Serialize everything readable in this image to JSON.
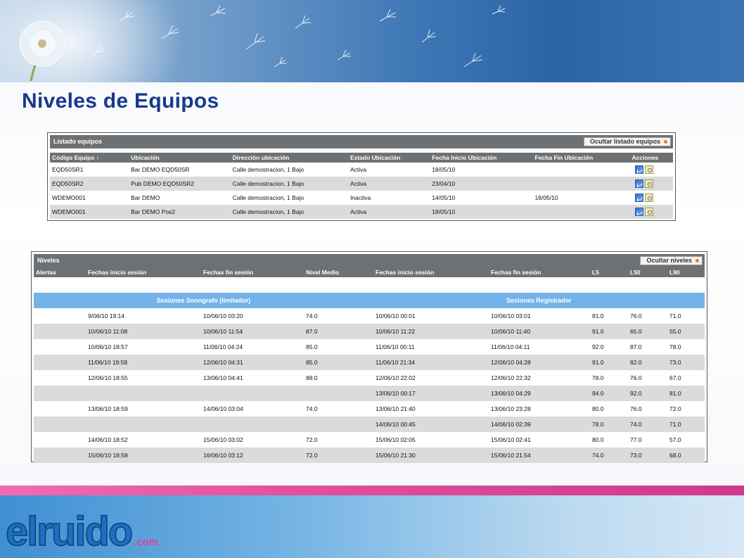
{
  "page": {
    "title": "Niveles de Equipos"
  },
  "equipos": {
    "panel_title": "Listado equipos",
    "hide_label": "Ocultar listado equipos",
    "columns": [
      "Código Equipo ↑",
      "Ubicación",
      "Dirección ubicación",
      "Estado Ubicación",
      "Fecha Inicio Ubicación",
      "Fecha Fin Ubicación",
      "Acciones"
    ],
    "rows": [
      [
        "EQD50SR1",
        "Bar DEMO EQD50SR",
        "Calle demostracion, 1 Bajo",
        "Activa",
        "18/05/10",
        ""
      ],
      [
        "EQD50SR2",
        "Pub DEMO EQD50SR2",
        "Calle demostracion, 1 Bajo",
        "Activa",
        "23/04/10",
        ""
      ],
      [
        "WDEMO001",
        "Bar DEMO",
        "Calle demostracion, 1 Bajo",
        "Inactiva",
        "14/05/10",
        "18/05/10"
      ],
      [
        "WDEMO001",
        "Bar DEMO Pos2",
        "Calle demostracion, 1 Bajo",
        "Activa",
        "18/05/10",
        ""
      ]
    ],
    "action_icons": [
      "chart-icon",
      "document-icon"
    ]
  },
  "niveles": {
    "panel_title": "Niveles",
    "hide_label": "Ocultar niveles",
    "group_sonografo": "Sesiones Sonografo (limitador)",
    "group_registrador": "Sesiones Registrador",
    "columns": [
      "Alertas",
      "Fechas inicio sesión",
      "Fechas fin sesión",
      "Nivel Medio",
      "Fechas inicio sesión",
      "Fechas fin sesión",
      "L5",
      "L50",
      "L90"
    ],
    "rows": [
      [
        "",
        "9/06/10 19:14",
        "10/06/10 03:20",
        "74.0",
        "10/06/10 00:01",
        "10/06/10 03:01",
        "81.0",
        "76.0",
        "71.0"
      ],
      [
        "",
        "10/06/10 11:08",
        "10/06/10 11:54",
        "87.0",
        "10/06/10 11:22",
        "10/06/10 11:40",
        "91.0",
        "65.0",
        "55.0"
      ],
      [
        "",
        "10/06/10 18:57",
        "11/06/10 04:24",
        "85.0",
        "11/06/10 00:11",
        "11/06/10 04:11",
        "92.0",
        "87.0",
        "78.0"
      ],
      [
        "",
        "11/06/10 19:58",
        "12/06/10 04:31",
        "85.0",
        "11/06/10 21:34",
        "12/06/10 04:28",
        "91.0",
        "82.0",
        "73.0"
      ],
      [
        "",
        "12/06/10 18:55",
        "13/06/10 04:41",
        "88.0",
        "12/06/10 22:02",
        "12/06/10 22:32",
        "78.0",
        "76.0",
        "67.0"
      ],
      [
        "",
        "",
        "",
        "",
        "13/06/10 00:17",
        "13/06/10 04:29",
        "94.0",
        "92.0",
        "81.0"
      ],
      [
        "",
        "13/06/10 18:59",
        "14/06/10 03:04",
        "74.0",
        "13/06/10 21:40",
        "13/06/10 23:28",
        "80.0",
        "76.0",
        "72.0"
      ],
      [
        "",
        "",
        "",
        "",
        "14/06/10 00:45",
        "14/06/10 02:39",
        "78.0",
        "74.0",
        "71.0"
      ],
      [
        "",
        "14/06/10 18:52",
        "15/06/10 03:02",
        "72.0",
        "15/06/10 02:05",
        "15/06/10 02:41",
        "80.0",
        "77.0",
        "57.0"
      ],
      [
        "",
        "15/06/10 18:58",
        "16/06/10 03:12",
        "72.0",
        "15/06/10 21:30",
        "15/06/10 21:54",
        "74.0",
        "73.0",
        "68.0"
      ]
    ]
  },
  "footer": {
    "logo_text": "elruido",
    "logo_suffix": ".com"
  },
  "colors": {
    "title": "#173a8c",
    "panel_header": "#6e7173",
    "group_header": "#74b3ea",
    "row_alt": "#d9dbdd",
    "footer_pink": "#e2509f",
    "footer_blue": "#3f8fd2"
  }
}
